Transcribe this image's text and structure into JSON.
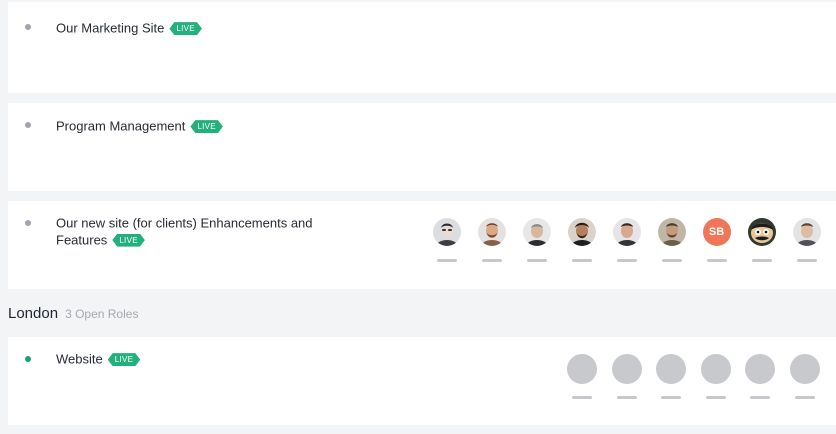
{
  "projects": [
    {
      "title": "Our Marketing Site",
      "badge": "LIVE"
    },
    {
      "title": "Program Management",
      "badge": "LIVE"
    },
    {
      "title": "Our new site (for clients) Enhancements and Features",
      "badge": "LIVE",
      "members": [
        {
          "type": "photo",
          "icon": "avatar-photo"
        },
        {
          "type": "photo",
          "icon": "avatar-photo"
        },
        {
          "type": "photo",
          "icon": "avatar-photo"
        },
        {
          "type": "photo",
          "icon": "avatar-photo"
        },
        {
          "type": "photo",
          "icon": "avatar-photo"
        },
        {
          "type": "photo",
          "icon": "avatar-photo"
        },
        {
          "type": "initials",
          "initials": "SB",
          "color": "#f0765a"
        },
        {
          "type": "photo",
          "icon": "avatar-cartoon"
        },
        {
          "type": "photo",
          "icon": "avatar-photo"
        }
      ]
    }
  ],
  "section": {
    "city": "London",
    "roles": "3 Open Roles",
    "projects": [
      {
        "title": "Website",
        "badge": "LIVE",
        "open_slots": 6
      }
    ]
  },
  "colors": {
    "live_badge": "#22b07d",
    "status_dot_active": "#1aa276",
    "status_dot_default": "#a0a4ad"
  }
}
